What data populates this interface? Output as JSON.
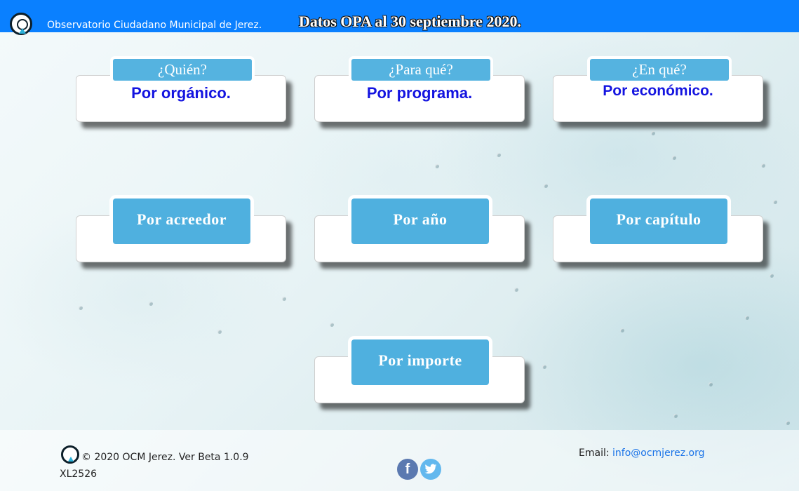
{
  "header": {
    "site_name": "Observatorio Ciudadano Municipal de Jerez.",
    "title": "Datos OPA al 30 septiembre 2020."
  },
  "cards_row1": [
    {
      "question": "¿Quién?",
      "label": "Por orgánico."
    },
    {
      "question": "¿Para qué?",
      "label": "Por programa."
    },
    {
      "question": "¿En qué?",
      "label": "Por económico."
    }
  ],
  "cards_row2": [
    {
      "label": "Por acreedor"
    },
    {
      "label": "Por año"
    },
    {
      "label": "Por capítulo"
    }
  ],
  "cards_row3": [
    {
      "label": "Por importe"
    }
  ],
  "footer": {
    "copyright": "© 2020 OCM Jerez. Ver Beta 1.0.9",
    "build": "XL2526",
    "email_label": "Email:",
    "email": "info@ocmjerez.org",
    "social": [
      {
        "name": "facebook",
        "glyph": "f"
      },
      {
        "name": "twitter",
        "glyph": "🐦"
      }
    ]
  },
  "colors": {
    "header_bg": "#0a80ff",
    "tab_bg": "#55b3e0",
    "label_blue": "#1414e0",
    "link": "#1a73e8"
  },
  "icons": {
    "logo": "ocm-logo-icon",
    "facebook": "facebook-icon",
    "twitter": "twitter-icon"
  }
}
